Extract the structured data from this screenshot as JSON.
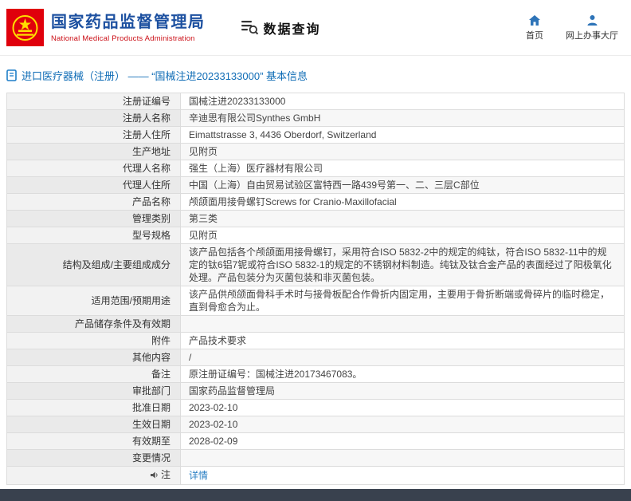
{
  "colors": {
    "brand_blue": "#1c50a0",
    "brand_red": "#cb0e16",
    "breadcrumb_blue": "#0f6cb6",
    "link_blue": "#2a7fc3",
    "nav_icon_blue": "#2e74b8",
    "emblem_red": "#e0000c",
    "footer_dark": "#39414e"
  },
  "header": {
    "agency_name_cn": "国家药品监督管理局",
    "agency_name_en": "National Medical Products Administration",
    "module_title": "数据查询",
    "nav_home": "首页",
    "nav_service_hall": "网上办事大厅"
  },
  "breadcrumb": {
    "title": "进口医疗器械（注册） —— “国械注进20233133000” 基本信息"
  },
  "table": {
    "rows": [
      {
        "label": "注册证编号",
        "value": "国械注进20233133000"
      },
      {
        "label": "注册人名称",
        "value": "辛迪思有限公司Synthes GmbH"
      },
      {
        "label": "注册人住所",
        "value": "Eimattstrasse 3, 4436 Oberdorf, Switzerland"
      },
      {
        "label": "生产地址",
        "value": "见附页"
      },
      {
        "label": "代理人名称",
        "value": "强生（上海）医疗器材有限公司"
      },
      {
        "label": "代理人住所",
        "value": "中国（上海）自由贸易试验区富特西一路439号第一、二、三层C部位"
      },
      {
        "label": "产品名称",
        "value": "颅颌面用接骨螺钉Screws for Cranio-Maxillofacial"
      },
      {
        "label": "管理类别",
        "value": "第三类"
      },
      {
        "label": "型号规格",
        "value": "见附页"
      },
      {
        "label": "结构及组成/主要组成成分",
        "value": "该产品包括各个颅颌面用接骨螺钉，采用符合ISO 5832-2中的规定的纯钛，符合ISO 5832-11中的规定的钛6铝7铌或符合ISO 5832-1的规定的不锈钢材料制造。纯钛及钛合金产品的表面经过了阳极氧化处理。产品包装分为灭菌包装和非灭菌包装。"
      },
      {
        "label": "适用范围/预期用途",
        "value": "该产品供颅颌面骨科手术时与接骨板配合作骨折内固定用，主要用于骨折断端或骨碎片的临时稳定，直到骨愈合为止。"
      },
      {
        "label": "产品储存条件及有效期",
        "value": ""
      },
      {
        "label": "附件",
        "value": "产品技术要求"
      },
      {
        "label": "其他内容",
        "value": "/"
      },
      {
        "label": "备注",
        "value": "原注册证编号：国械注进20173467083。"
      },
      {
        "label": "审批部门",
        "value": "国家药品监督管理局"
      },
      {
        "label": "批准日期",
        "value": "2023-02-10"
      },
      {
        "label": "生效日期",
        "value": "2023-02-10"
      },
      {
        "label": "有效期至",
        "value": "2028-02-09"
      },
      {
        "label": "变更情况",
        "value": ""
      }
    ]
  },
  "note_row": {
    "label": "注",
    "link_label": "详情"
  }
}
